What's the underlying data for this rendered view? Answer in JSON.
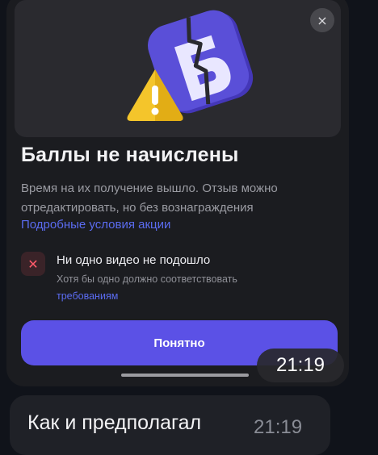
{
  "dialog": {
    "close_icon": "×",
    "title": "Баллы не начислены",
    "description": "Время на их получение вышло. Отзыв можно отредактировать, но без вознаграждения",
    "terms_link": "Подробные условия акции",
    "fail": {
      "icon": "✕",
      "title": "Ни одно видео не подошло",
      "subtitle": "Хотя бы одно должно соответствовать",
      "subtitle_link": "требованиям"
    },
    "ok_button": "Понятно",
    "time": "21:19"
  },
  "message": {
    "text": "Как и предполагал",
    "time": "21:19"
  },
  "colors": {
    "accent": "#5b51e6",
    "link": "#5b6cf2",
    "error": "#ff5a6a",
    "logo_purple": "#5a4fd8",
    "warning_yellow": "#f4c52b"
  },
  "icons": {
    "logo": "broken-logo-icon",
    "warning": "warning-icon"
  }
}
